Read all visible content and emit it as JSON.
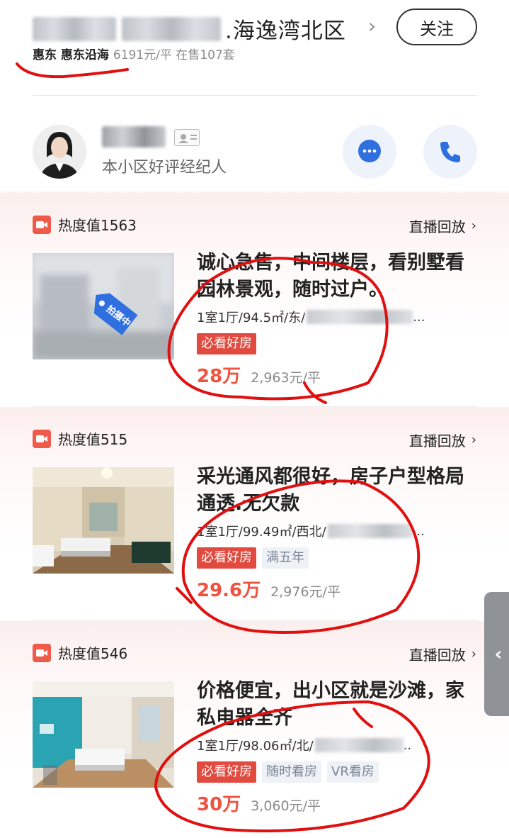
{
  "header": {
    "title_suffix": ".海逸湾北区",
    "follow_label": "关注",
    "area": "惠东 惠东沿海",
    "meta": "6191元/平 在售107套"
  },
  "agent": {
    "label": "本小区好评经纪人"
  },
  "listings": [
    {
      "heat": "热度值1563",
      "replay": "直播回放",
      "badge": "拍摄中",
      "title": "诚心急售，中间楼层，看别墅看园林景观，随时过户。",
      "spec": "1室1厅/94.5㎡/东/",
      "tags": [
        "必看好房"
      ],
      "price": "28万",
      "unit_price": "2,963元/平"
    },
    {
      "heat": "热度值515",
      "replay": "直播回放",
      "title": "采光通风都很好，房子户型格局通透.无欠款",
      "spec": "1室1厅/99.49㎡/西北/",
      "tags": [
        "必看好房",
        "满五年"
      ],
      "price": "29.6万",
      "unit_price": "2,976元/平"
    },
    {
      "heat": "热度值546",
      "replay": "直播回放",
      "title": "价格便宜，出小区就是沙滩，家私电器全齐",
      "spec": "1室1厅/98.06㎡/北/",
      "tags": [
        "必看好房",
        "随时看房",
        "VR看房"
      ],
      "price": "30万",
      "unit_price": "3,060元/平"
    }
  ],
  "colors": {
    "accent_red": "#f0523f",
    "tag_red": "#e04a3f",
    "annotation_red": "#e01010"
  },
  "icons": {
    "chevron": "chevron-right-icon",
    "chat": "chat-bubble-icon",
    "phone": "phone-icon",
    "video": "video-camera-icon",
    "side": "chevron-left-icon"
  }
}
